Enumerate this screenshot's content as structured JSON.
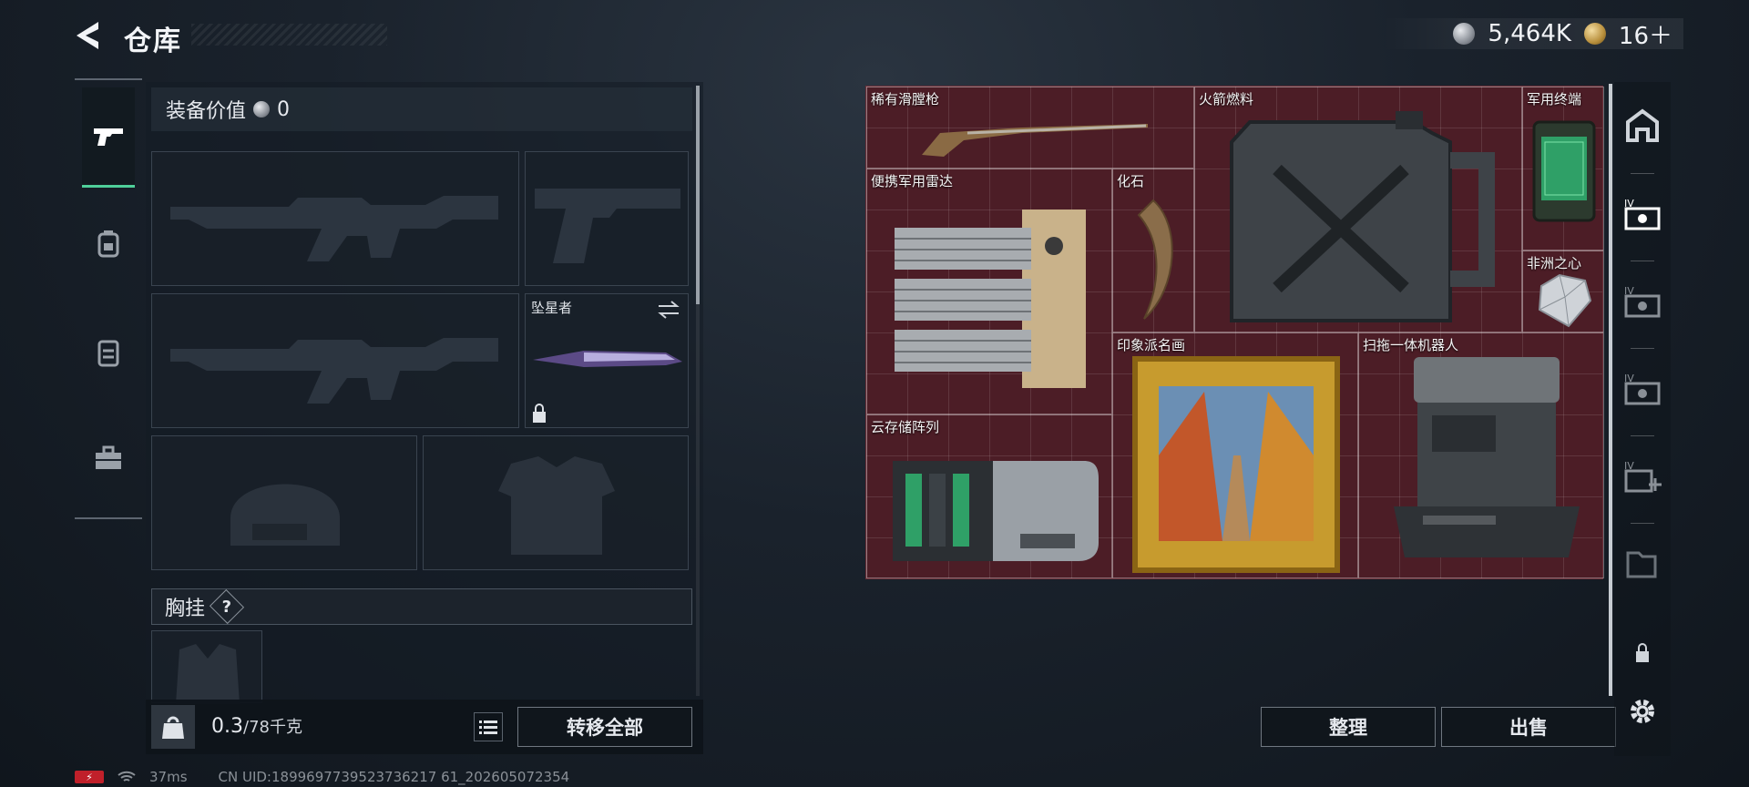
{
  "header": {
    "title": "仓库",
    "currencies": [
      {
        "icon": "silver-coin-icon",
        "value": "5,464K"
      },
      {
        "icon": "gold-coin-icon",
        "value": "16＋"
      }
    ]
  },
  "left_tabs": [
    "pistol-icon",
    "backpack-icon",
    "vest-icon",
    "toolbox-icon"
  ],
  "equipment": {
    "value_label": "装备价值",
    "value": "0",
    "melee_slot_label": "坠星者",
    "chest_rig_label": "胸挂",
    "help_glyph": "?"
  },
  "footer_left": {
    "weight_current": "0.3",
    "weight_max": "/78千克",
    "transfer_all_label": "转移全部"
  },
  "storage_items": [
    {
      "label": "稀有滑膛枪",
      "icon": "musket-icon"
    },
    {
      "label": "火箭燃料",
      "icon": "fuel-jerrycan-icon"
    },
    {
      "label": "军用终端",
      "icon": "military-terminal-icon"
    },
    {
      "label": "便携军用雷达",
      "icon": "portable-radar-icon"
    },
    {
      "label": "化石",
      "icon": "fossil-claw-icon"
    },
    {
      "label": "非洲之心",
      "icon": "diamond-icon"
    },
    {
      "label": "印象派名画",
      "icon": "framed-painting-icon"
    },
    {
      "label": "扫拖一体机器人",
      "icon": "robot-mop-icon"
    },
    {
      "label": "云存储阵列",
      "icon": "storage-array-icon"
    }
  ],
  "storage_footer": {
    "sort_label": "整理",
    "sell_label": "出售"
  },
  "right_tabs": [
    "house-icon",
    "storage-box-icon",
    "storage-box-icon",
    "storage-box-icon",
    "add-storage-icon",
    "folder-icon",
    "lock-icon",
    "settings-icon"
  ],
  "status": {
    "ping": "37ms",
    "uid": "CN UID:1899697739523736217 61_202605072354"
  },
  "colors": {
    "grid_bg": "#4c1d26",
    "active_tab_accent": "#4fcf9a"
  }
}
